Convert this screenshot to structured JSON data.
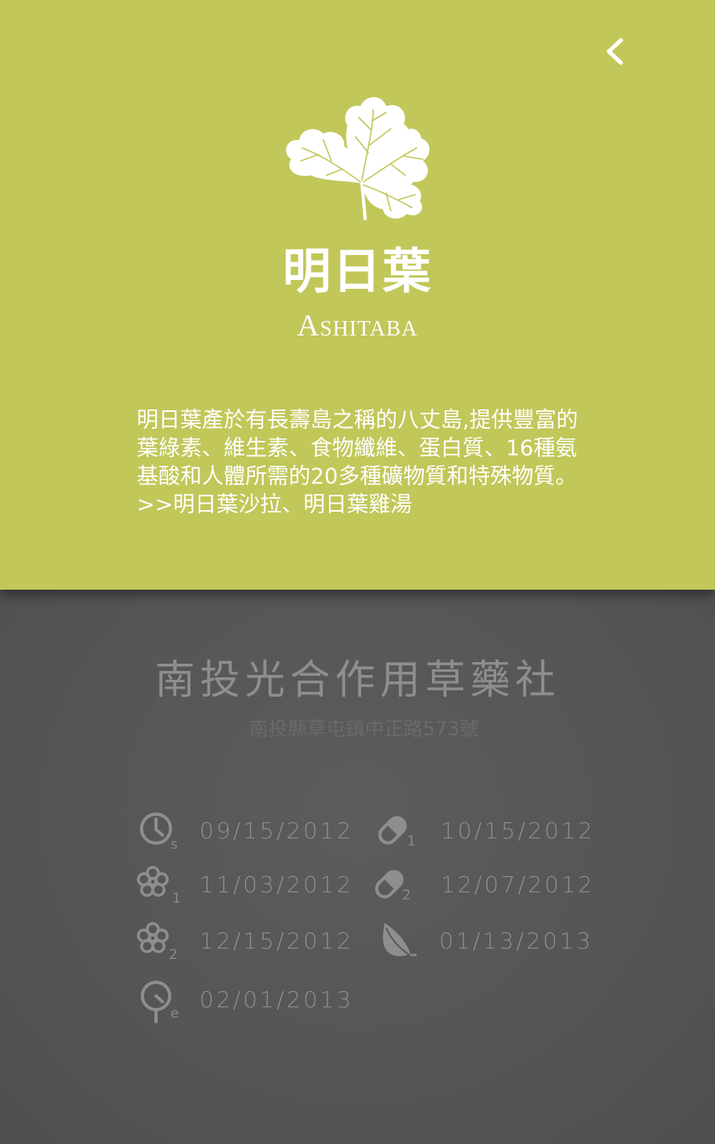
{
  "nav": {
    "back_icon": "chevron-left-icon"
  },
  "header": {
    "logo_icon": "leaf-icon",
    "title_zh": "明日葉",
    "title_en": "Ashitaba"
  },
  "description": {
    "lines": [
      "明日葉產於有長壽島之稱的八丈島,提供豐富的葉綠素、維生素、食物纖維、蛋白質、16種氨基酸和人體所需的20多種礦物質和特殊物質。",
      ">>明日葉沙拉、明日葉雞湯"
    ]
  },
  "shop": {
    "name": "南投光合作用草藥社",
    "address": "南投縣草屯鎮中正路573號"
  },
  "milestones": [
    {
      "icon": "clock-icon",
      "sub": "s",
      "date": "09/15/2012"
    },
    {
      "icon": "capsule-icon",
      "sub": "1",
      "date": "10/15/2012"
    },
    {
      "icon": "flower-icon",
      "sub": "1",
      "date": "11/03/2012"
    },
    {
      "icon": "capsule-icon",
      "sub": "2",
      "date": "12/07/2012"
    },
    {
      "icon": "flower-icon",
      "sub": "2",
      "date": "12/15/2012"
    },
    {
      "icon": "leaf-icon",
      "sub": "",
      "date": "01/13/2013"
    },
    {
      "icon": "timer-icon",
      "sub": "e",
      "date": "02/01/2013"
    }
  ],
  "colors": {
    "panel_green": "#c1c759",
    "panel_dark": "#575757",
    "text_white": "#ffffff",
    "text_gray": "#8e8e8e"
  }
}
